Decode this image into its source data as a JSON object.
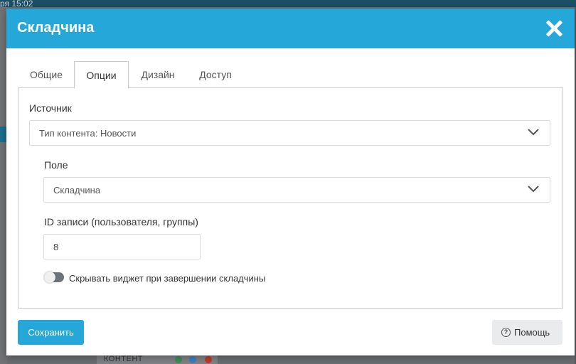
{
  "background": {
    "topbar_text": "ря 15:02",
    "bottom_label": "КОНТЕНТ"
  },
  "modal": {
    "title": "Складчина",
    "close_icon": "close-icon",
    "tabs": [
      {
        "label": "Общие",
        "active": false
      },
      {
        "label": "Опции",
        "active": true
      },
      {
        "label": "Дизайн",
        "active": false
      },
      {
        "label": "Доступ",
        "active": false
      }
    ],
    "source": {
      "label": "Источник",
      "value": "Тип контента: Новости"
    },
    "field": {
      "label": "Поле",
      "value": "Складчина"
    },
    "record_id": {
      "label": "ID записи (пользователя, группы)",
      "value": "8"
    },
    "hide_widget": {
      "label": "Скрывать виджет при завершении складчины",
      "checked": false
    },
    "buttons": {
      "save": "Сохранить",
      "help": "Помощь",
      "help_icon": "question-circle-icon"
    }
  },
  "colors": {
    "header": "#26a7d9",
    "save_button": "#26a7d9",
    "toggle_off": "#6e757a"
  }
}
